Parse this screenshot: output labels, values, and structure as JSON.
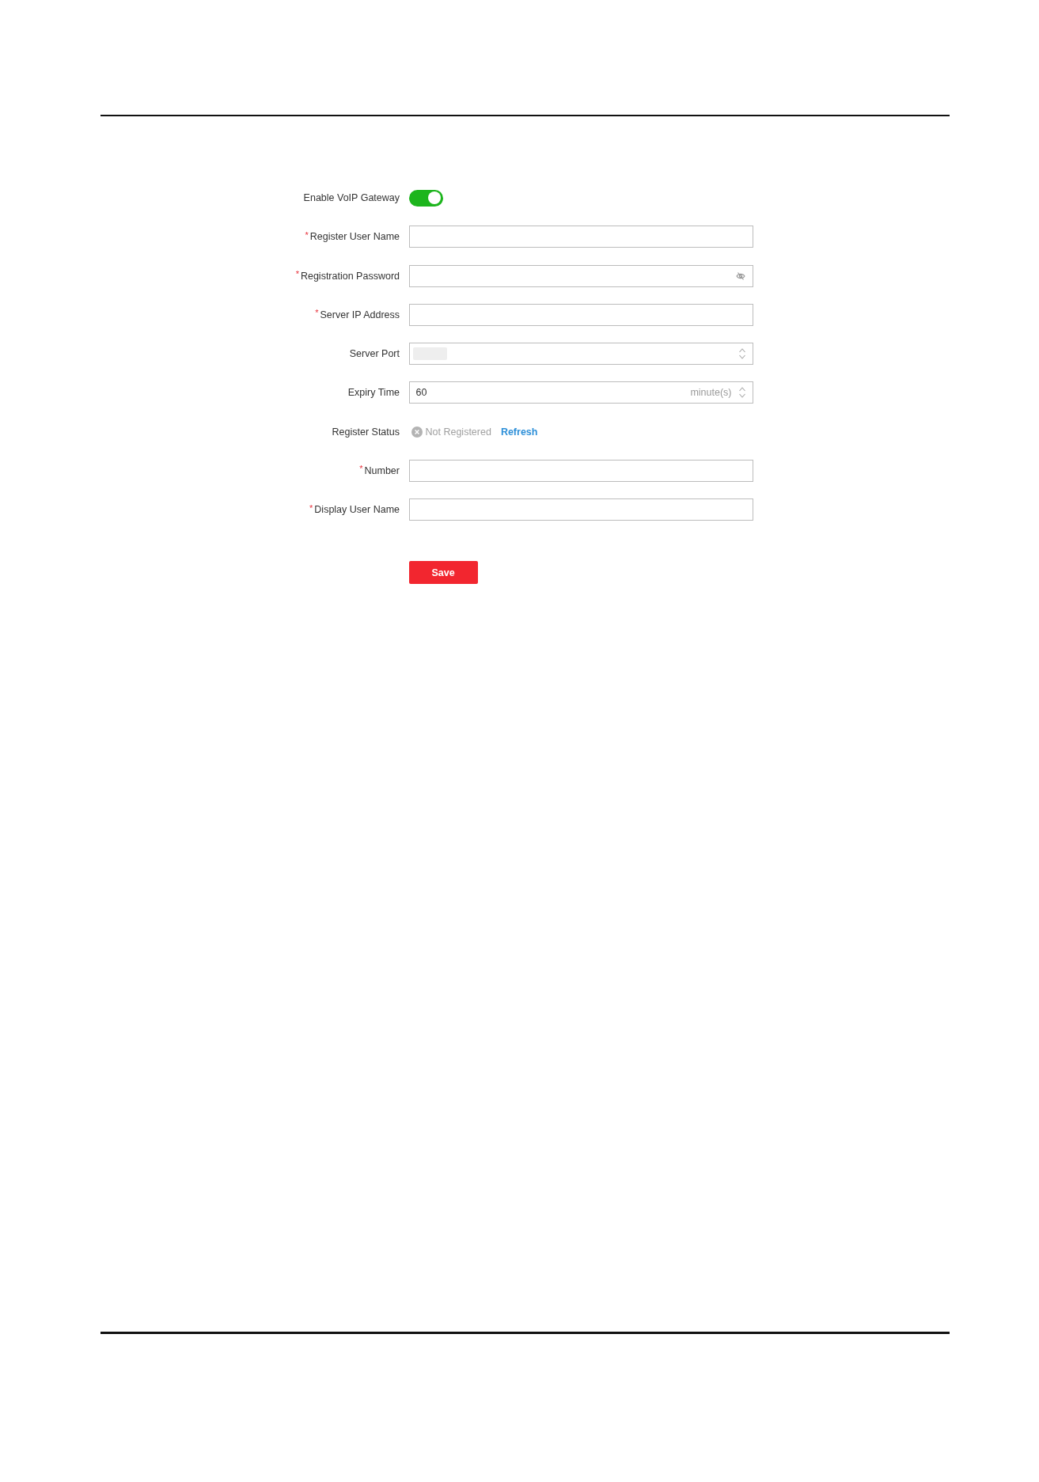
{
  "form": {
    "fields": [
      {
        "kind": "toggle",
        "label": "Enable VoIP Gateway",
        "on": true
      },
      {
        "kind": "text",
        "label": "Register User Name",
        "required_mark": "*"
      },
      {
        "kind": "password",
        "label": "Registration Password",
        "required_mark": "*"
      },
      {
        "kind": "text",
        "label": "Server IP Address",
        "required_mark": "*"
      },
      {
        "kind": "spinner",
        "label": "Server Port",
        "redacted": true
      },
      {
        "kind": "spinner",
        "label": "Expiry Time",
        "value": "60",
        "unit": "minute(s)"
      },
      {
        "kind": "status",
        "label": "Register Status",
        "registered": false,
        "status": "Not Registered",
        "link": "Refresh"
      },
      {
        "kind": "text",
        "label": "Number",
        "required_mark": "*"
      },
      {
        "kind": "text",
        "label": "Display User Name",
        "required_mark": "*"
      }
    ],
    "save_button": "Save"
  }
}
